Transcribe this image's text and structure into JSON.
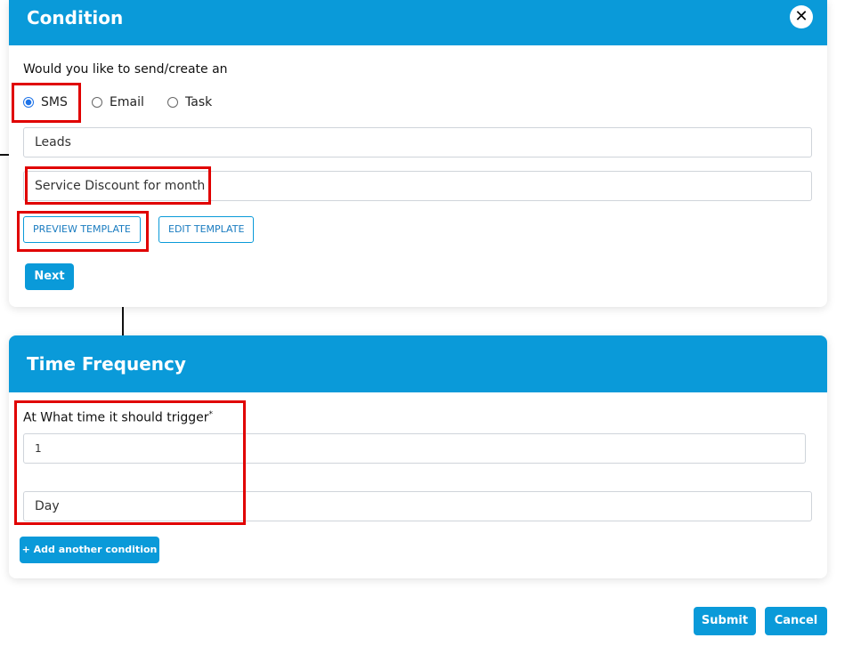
{
  "condition": {
    "title": "Condition",
    "close_glyph": "✕",
    "question": "Would you like to send/create an",
    "options": [
      {
        "label": "SMS",
        "selected": true
      },
      {
        "label": "Email",
        "selected": false
      },
      {
        "label": "Task",
        "selected": false
      }
    ],
    "audience_value": "Leads",
    "template_value": "Service Discount for month",
    "preview_btn": "PREVIEW TEMPLATE",
    "edit_btn": "EDIT TEMPLATE",
    "next_btn": "Next"
  },
  "time_frequency": {
    "title": "Time Frequency",
    "trigger_label": "At What time it should trigger",
    "required_mark": "*",
    "amount_value": "1",
    "unit_value": "Day",
    "add_condition_btn": "+ Add another condition"
  },
  "footer": {
    "submit_btn": "Submit",
    "cancel_btn": "Cancel"
  },
  "colors": {
    "primary": "#0a9ad9",
    "highlight": "#e00000"
  }
}
